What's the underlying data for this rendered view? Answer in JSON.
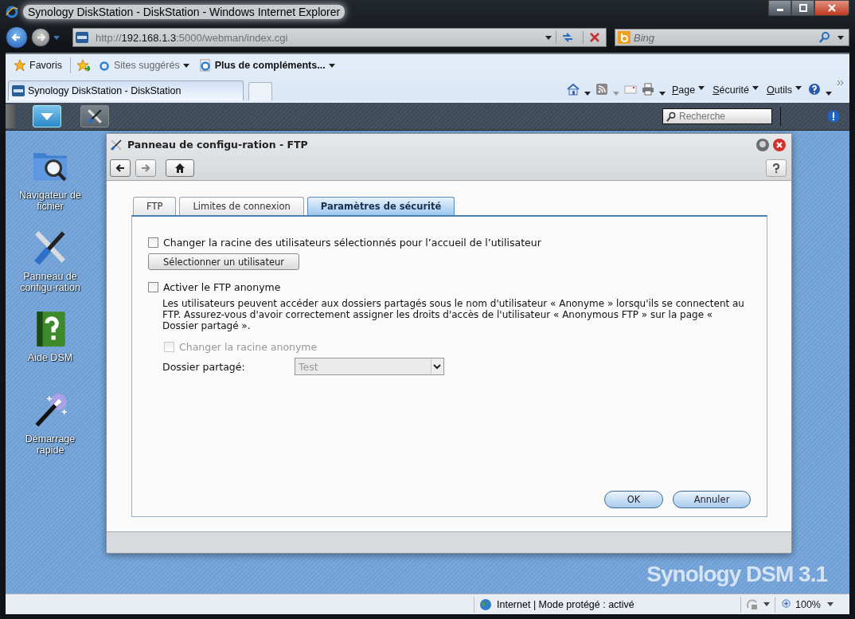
{
  "browser": {
    "title": "Synology DiskStation - DiskStation - Windows Internet Explorer",
    "address": [
      {
        "text": "http://",
        "highlight": false
      },
      {
        "text": "192.168.1.3",
        "highlight": true
      },
      {
        "text": ":5000/webman/index.cgi",
        "highlight": false
      }
    ],
    "search_placeholder": "Bing",
    "favorites_label": "Favoris",
    "links": [
      {
        "label": "Sites suggérés",
        "bold": false
      },
      {
        "label": "Plus de compléments...",
        "bold": true
      }
    ],
    "tabs": [
      {
        "label": "Synology DiskStation - DiskStation",
        "selected": true
      }
    ],
    "commands": [
      "Page",
      "Sécurité",
      "Outils"
    ],
    "status": {
      "zone": "Internet | Mode protégé : activé",
      "zoom": "100%"
    }
  },
  "dsm": {
    "search_placeholder": "Recherche",
    "desktop_icons": [
      {
        "label": "Navigateur de fichier",
        "kind": "file-browser"
      },
      {
        "label": "Panneau de configu-ration",
        "kind": "control-panel"
      },
      {
        "label": "Aide DSM",
        "kind": "help"
      },
      {
        "label": "Démarrage rapide",
        "kind": "wizard"
      }
    ],
    "logo": "Synology DSM 3.1"
  },
  "dialog": {
    "title": "Panneau de configu-ration - FTP",
    "tabs": [
      {
        "label": "FTP",
        "selected": false
      },
      {
        "label": "Limites de connexion",
        "selected": false
      },
      {
        "label": "Paramètres de sécurité",
        "selected": true
      }
    ],
    "change_root": {
      "label": "Changer la racine des utilisateurs sélectionnés pour l’accueil de l’utilisateur",
      "checked": false,
      "disabled": false
    },
    "select_user_button": "Sélectionner un utilisateur",
    "anonymous": {
      "label": "Activer le FTP anonyme",
      "checked": false,
      "disabled": false
    },
    "description": "Les utilisateurs peuvent accéder aux dossiers partagés sous le nom d'utilisateur « Anonyme » lorsqu'ils se connectent au FTP. Assurez-vous d'avoir correctement assigner les droits d'accès de l'utilisateur « Anonymous FTP » sur la page « Dossier partagé ».",
    "anonymous_root": {
      "label": "Changer la racine anonyme",
      "checked": false,
      "disabled": true
    },
    "shared_folder": {
      "label": "Dossier partagé:",
      "value": "Test",
      "disabled": true
    },
    "buttons": [
      "OK",
      "Annuler"
    ]
  }
}
